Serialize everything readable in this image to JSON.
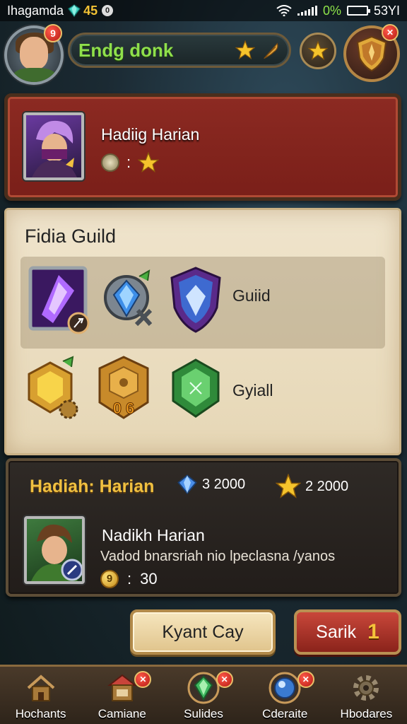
{
  "status_bar": {
    "app_name": "Ihagamda",
    "gem_count": "45",
    "badge": "0",
    "battery_pct": "0%",
    "signal_text": "53YI"
  },
  "header": {
    "avatar_badge": "9",
    "player_name": "Endg donk",
    "shield_badge": "✕"
  },
  "featured": {
    "title": "Hadiig Harian",
    "separator": ":"
  },
  "guild": {
    "title": "Fidia Guild",
    "row1_label": "Guiid",
    "row2_label": "Gyiall",
    "amber_box_label": "0 6"
  },
  "rewards": {
    "title": "Hadiah: Harian",
    "gem_reward": "3 2000",
    "star_reward": "2 2000",
    "mission_title": "Nadikh Harian",
    "mission_desc": "Vadod bnarsriah nio lpeclasna /yanos",
    "coin_symbol": "9",
    "separator": ":",
    "mission_value": "30"
  },
  "actions": {
    "claim_label": "Kyant Cay",
    "back_label": "Sarik",
    "back_count": "1"
  },
  "nav": {
    "items": [
      {
        "label": "Hochants",
        "icon": "home-icon"
      },
      {
        "label": "Camiane",
        "icon": "shop-icon",
        "badge": "✕"
      },
      {
        "label": "Sulides",
        "icon": "gem-icon",
        "badge": "✕"
      },
      {
        "label": "Cderaite",
        "icon": "orb-icon",
        "badge": "✕"
      },
      {
        "label": "Hbodares",
        "icon": "gear-icon"
      }
    ]
  },
  "colors": {
    "name_green": "#8fe04b",
    "reward_gold": "#f0c040",
    "banner_red": "#8c2a22",
    "parchment": "#efe4cc"
  }
}
